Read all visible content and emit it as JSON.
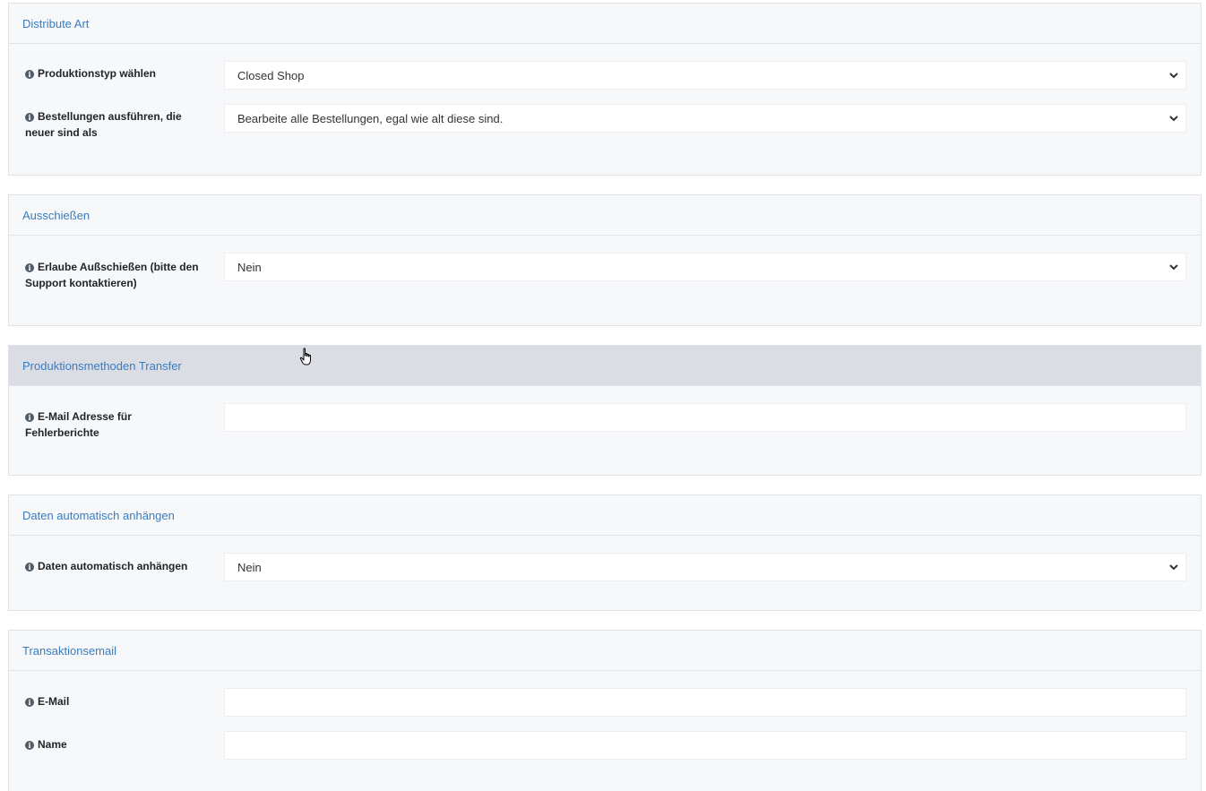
{
  "sections": [
    {
      "title": "Distribute Art",
      "fields": [
        {
          "label": "Produktionstyp wählen",
          "type": "select",
          "value": "Closed Shop"
        },
        {
          "label": "Bestellungen ausführen, die neuer sind als",
          "type": "select",
          "value": "Bearbeite alle Bestellungen, egal wie alt diese sind."
        }
      ]
    },
    {
      "title": "Ausschießen",
      "fields": [
        {
          "label": "Erlaube Außschießen (bitte den Support kontaktieren)",
          "type": "select",
          "value": "Nein"
        }
      ]
    },
    {
      "title": "Produktionsmethoden Transfer",
      "hovered": true,
      "fields": [
        {
          "label": "E-Mail Adresse für Fehlerberichte",
          "type": "input",
          "value": ""
        }
      ]
    },
    {
      "title": "Daten automatisch anhängen",
      "fields": [
        {
          "label": "Daten automatisch anhängen",
          "type": "select",
          "value": "Nein"
        }
      ]
    },
    {
      "title": "Transaktionsemail",
      "fields": [
        {
          "label": "E-Mail",
          "type": "input",
          "value": ""
        },
        {
          "label": "Name",
          "type": "input",
          "value": ""
        }
      ]
    }
  ],
  "icons": {
    "info": "info-circle-icon",
    "chevron": "chevron-down-icon",
    "cursor": "hand-pointer-icon"
  },
  "colors": {
    "title": "#3a7bbf",
    "panel_bg": "#f7f8fa",
    "hover_header": "#dadee4"
  }
}
